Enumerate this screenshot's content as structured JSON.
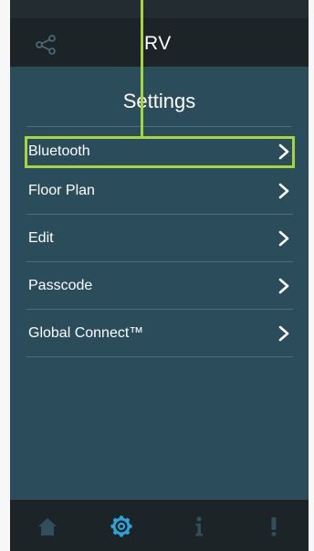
{
  "header": {
    "title": "RV",
    "share_icon": "share-icon"
  },
  "page": {
    "title": "Settings"
  },
  "menu": {
    "items": [
      {
        "label": "Bluetooth",
        "icon": "chevron-right-icon",
        "highlighted": true
      },
      {
        "label": "Floor Plan",
        "icon": "chevron-right-icon",
        "highlighted": false
      },
      {
        "label": "Edit",
        "icon": "chevron-right-icon",
        "highlighted": false
      },
      {
        "label": "Passcode",
        "icon": "chevron-right-icon",
        "highlighted": false
      },
      {
        "label": "Global Connect™",
        "icon": "chevron-right-icon",
        "highlighted": false
      }
    ]
  },
  "tabbar": {
    "items": [
      {
        "icon": "home-icon",
        "active": false
      },
      {
        "icon": "gear-icon",
        "active": true
      },
      {
        "icon": "info-icon",
        "active": false
      },
      {
        "icon": "alert-icon",
        "active": false
      }
    ]
  },
  "colors": {
    "background": "#2a4c5b",
    "bar": "#1c2428",
    "highlight": "#a7d63a",
    "active_tab": "#2aa6d6",
    "inactive_tab": "#2f4f5d"
  }
}
